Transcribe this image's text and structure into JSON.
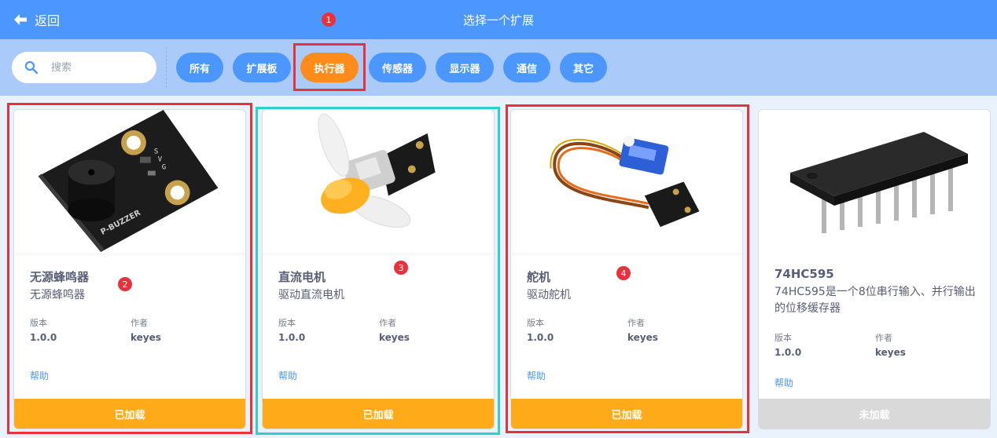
{
  "header": {
    "back_label": "返回",
    "title": "选择一个扩展"
  },
  "search": {
    "placeholder": "搜索",
    "value": ""
  },
  "filters": [
    "所有",
    "扩展板",
    "执行器",
    "传感器",
    "显示器",
    "通信",
    "其它"
  ],
  "active_filter": "执行器",
  "badges": [
    "1",
    "2",
    "3",
    "4"
  ],
  "meta_labels": {
    "version": "版本",
    "author": "作者",
    "help": "帮助"
  },
  "cards": [
    {
      "title": "无源蜂鸣器",
      "desc": "无源蜂鸣器",
      "version": "1.0.0",
      "author": "keyes",
      "button": "已加载",
      "loaded": true,
      "image_label": "P-BUZZER"
    },
    {
      "title": "直流电机",
      "desc": "驱动直流电机",
      "version": "1.0.0",
      "author": "keyes",
      "button": "已加载",
      "loaded": true
    },
    {
      "title": "舵机",
      "desc": "驱动舵机",
      "version": "1.0.0",
      "author": "keyes",
      "button": "已加载",
      "loaded": true
    },
    {
      "title": "74HC595",
      "desc": "74HC595是一个8位串行输入、并行输出的位移缓存器",
      "version": "1.0.0",
      "author": "keyes",
      "button": "未加载",
      "loaded": false
    }
  ],
  "colors": {
    "primary": "#4c97ff",
    "active": "#ff8c1a",
    "loaded": "#ffab19",
    "unloaded": "#d9d9d9",
    "highlight_red": "#e8313b",
    "highlight_cyan": "#2ecfd0"
  }
}
